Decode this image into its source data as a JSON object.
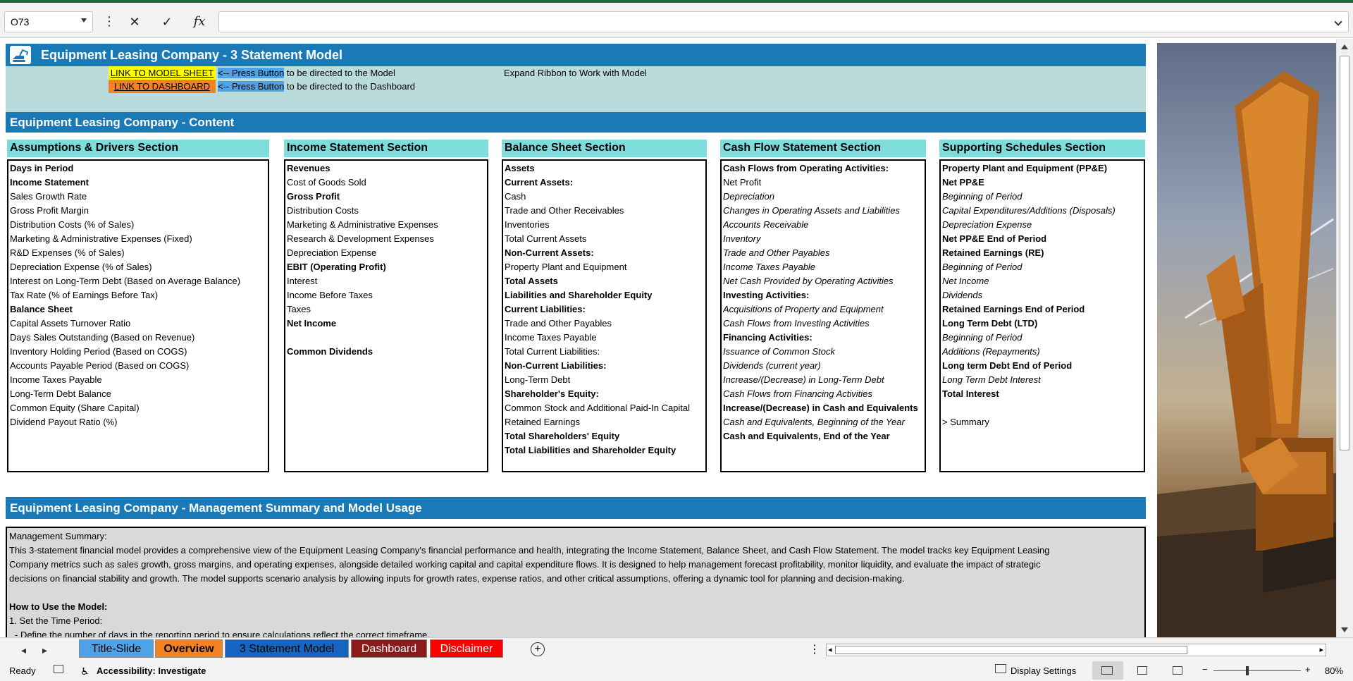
{
  "formula_bar": {
    "name_box": "O73",
    "cancel_glyph": "✕",
    "enter_glyph": "✓",
    "fx_glyph": "fx",
    "formula": ""
  },
  "header": {
    "title": "Equipment Leasing Company - 3 Statement Model",
    "link_model": "LINK TO MODEL SHEET",
    "link_dashboard": "LINK TO DASHBOARD",
    "press_prefix": "<-- Press Butt",
    "press_hl_tail": "on",
    "press_model_rest": " to be directed to the Model",
    "press_dashboard_rest": " to be directed to the Dashboard",
    "expand_note": "Expand Ribbon to Work with Model"
  },
  "content_title": "Equipment Leasing Company - Content",
  "sections": [
    {
      "title": "Assumptions & Drivers Section",
      "rows": [
        {
          "t": "Days in Period",
          "s": "b"
        },
        {
          "t": "Income Statement",
          "s": "b"
        },
        {
          "t": "Sales Growth Rate",
          "s": ""
        },
        {
          "t": "Gross Profit Margin",
          "s": ""
        },
        {
          "t": "Distribution Costs (% of Sales)",
          "s": ""
        },
        {
          "t": "Marketing & Administrative Expenses (Fixed)",
          "s": ""
        },
        {
          "t": "R&D Expenses (% of Sales)",
          "s": ""
        },
        {
          "t": "Depreciation Expense (% of Sales)",
          "s": ""
        },
        {
          "t": "Interest on Long-Term Debt (Based on Average Balance)",
          "s": ""
        },
        {
          "t": "Tax Rate (% of Earnings Before Tax)",
          "s": ""
        },
        {
          "t": "Balance Sheet",
          "s": "b"
        },
        {
          "t": "Capital Assets Turnover Ratio",
          "s": ""
        },
        {
          "t": "Days Sales Outstanding (Based on Revenue)",
          "s": ""
        },
        {
          "t": "Inventory Holding Period (Based on COGS)",
          "s": ""
        },
        {
          "t": "Accounts Payable Period (Based on COGS)",
          "s": ""
        },
        {
          "t": "Income Taxes Payable",
          "s": ""
        },
        {
          "t": "Long-Term Debt Balance",
          "s": ""
        },
        {
          "t": "Common Equity (Share Capital)",
          "s": ""
        },
        {
          "t": "Dividend Payout Ratio (%)",
          "s": ""
        }
      ]
    },
    {
      "title": "Income Statement Section",
      "rows": [
        {
          "t": "Revenues",
          "s": "b"
        },
        {
          "t": "Cost of Goods Sold",
          "s": ""
        },
        {
          "t": "Gross Profit",
          "s": "b"
        },
        {
          "t": "Distribution Costs",
          "s": ""
        },
        {
          "t": "Marketing & Administrative Expenses",
          "s": ""
        },
        {
          "t": "Research & Development Expenses",
          "s": ""
        },
        {
          "t": "Depreciation Expense",
          "s": ""
        },
        {
          "t": "EBIT (Operating Profit)",
          "s": "b"
        },
        {
          "t": "Interest",
          "s": ""
        },
        {
          "t": "Income Before Taxes",
          "s": ""
        },
        {
          "t": "Taxes",
          "s": ""
        },
        {
          "t": "Net Income",
          "s": "b"
        },
        {
          "t": "",
          "s": ""
        },
        {
          "t": "Common Dividends",
          "s": "b"
        }
      ]
    },
    {
      "title": "Balance Sheet Section",
      "rows": [
        {
          "t": "Assets",
          "s": "b"
        },
        {
          "t": "Current Assets:",
          "s": "b"
        },
        {
          "t": "Cash",
          "s": ""
        },
        {
          "t": "Trade and Other Receivables",
          "s": ""
        },
        {
          "t": "Inventories",
          "s": ""
        },
        {
          "t": "Total Current Assets",
          "s": ""
        },
        {
          "t": "Non-Current Assets:",
          "s": "b"
        },
        {
          "t": "Property Plant and Equipment",
          "s": ""
        },
        {
          "t": "Total Assets",
          "s": "b"
        },
        {
          "t": "Liabilities and Shareholder Equity",
          "s": "b"
        },
        {
          "t": "Current Liabilities:",
          "s": "b"
        },
        {
          "t": "Trade and Other Payables",
          "s": ""
        },
        {
          "t": "Income Taxes Payable",
          "s": ""
        },
        {
          "t": "Total Current Liabilities:",
          "s": ""
        },
        {
          "t": "Non-Current Liabilities:",
          "s": "b"
        },
        {
          "t": "Long-Term Debt",
          "s": ""
        },
        {
          "t": "Shareholder's Equity:",
          "s": "b"
        },
        {
          "t": "Common Stock and Additional Paid-In Capital",
          "s": ""
        },
        {
          "t": "Retained Earnings",
          "s": ""
        },
        {
          "t": "Total Shareholders' Equity",
          "s": "b"
        },
        {
          "t": "Total Liabilities and Shareholder Equity",
          "s": "b"
        }
      ]
    },
    {
      "title": "Cash Flow Statement Section",
      "rows": [
        {
          "t": "Cash Flows from Operating Activities:",
          "s": "b"
        },
        {
          "t": "Net Profit",
          "s": ""
        },
        {
          "t": "Depreciation",
          "s": "i"
        },
        {
          "t": "Changes in Operating Assets and Liabilities",
          "s": "i"
        },
        {
          "t": "Accounts Receivable",
          "s": "i"
        },
        {
          "t": "Inventory",
          "s": "i"
        },
        {
          "t": "Trade and Other Payables",
          "s": "i"
        },
        {
          "t": "Income Taxes Payable",
          "s": "i"
        },
        {
          "t": "Net Cash Provided by Operating Activities",
          "s": "i"
        },
        {
          "t": "Investing Activities:",
          "s": "b"
        },
        {
          "t": "Acquisitions of Property and Equipment",
          "s": "i"
        },
        {
          "t": "Cash Flows from Investing Activities",
          "s": "i"
        },
        {
          "t": "Financing Activities:",
          "s": "b"
        },
        {
          "t": "Issuance of Common Stock",
          "s": "i"
        },
        {
          "t": "Dividends (current year)",
          "s": "i"
        },
        {
          "t": "Increase/(Decrease) in Long-Term Debt",
          "s": "i"
        },
        {
          "t": "Cash Flows from Financing Activities",
          "s": "i"
        },
        {
          "t": "Increase/(Decrease) in Cash and Equivalents",
          "s": "b"
        },
        {
          "t": "Cash and Equivalents, Beginning of the Year",
          "s": "i"
        },
        {
          "t": "Cash and Equivalents, End of the Year",
          "s": "b"
        }
      ]
    },
    {
      "title": "Supporting Schedules Section",
      "rows": [
        {
          "t": "Property Plant and Equipment (PP&E)",
          "s": "b"
        },
        {
          "t": "Net PP&E",
          "s": "b"
        },
        {
          "t": "Beginning of Period",
          "s": "i"
        },
        {
          "t": "Capital Expenditures/Additions (Disposals)",
          "s": "i"
        },
        {
          "t": "Depreciation Expense",
          "s": "i"
        },
        {
          "t": "Net PP&E End of Period",
          "s": "b"
        },
        {
          "t": "Retained Earnings (RE)",
          "s": "b"
        },
        {
          "t": "Beginning of Period",
          "s": "i"
        },
        {
          "t": "Net Income",
          "s": "i"
        },
        {
          "t": "Dividends",
          "s": "i"
        },
        {
          "t": "Retained Earnings End of Period",
          "s": "b"
        },
        {
          "t": "Long Term Debt (LTD)",
          "s": "b"
        },
        {
          "t": "Beginning of Period",
          "s": "i"
        },
        {
          "t": "Additions (Repayments)",
          "s": "i"
        },
        {
          "t": "Long term Debt End of Period",
          "s": "b"
        },
        {
          "t": "Long Term Debt Interest",
          "s": "i"
        },
        {
          "t": "Total Interest",
          "s": "b"
        },
        {
          "t": "",
          "s": ""
        },
        {
          "t": "> Summary",
          "s": ""
        }
      ]
    }
  ],
  "summary_title": "Equipment Leasing Company - Management Summary and Model Usage",
  "summary": {
    "label": "Management Summary:",
    "line1": "This 3-statement financial model provides a comprehensive view of the Equipment Leasing Company's financial performance and health, integrating the Income Statement, Balance Sheet, and Cash Flow Statement. The model tracks key Equipment Leasing",
    "line2": "Company metrics such as sales growth, gross margins, and operating expenses, alongside detailed working capital and capital expenditure flows. It is designed to help management forecast profitability, monitor liquidity, and evaluate the impact of strategic",
    "line3": "decisions on financial stability and growth. The model supports scenario analysis by allowing inputs for growth rates, expense ratios, and other critical assumptions, offering a dynamic tool for planning and decision-making.",
    "how_title": "How to Use the Model:",
    "step1": "1. Set the Time Period:",
    "step1_detail": "- Define the number of days in the reporting period to ensure calculations reflect the correct timeframe."
  },
  "tabs": [
    {
      "label": "Title-Slide",
      "bg": "#4ea3e8",
      "fg": "#000000",
      "bold": false
    },
    {
      "label": "Overview",
      "bg": "#f58220",
      "fg": "#000000",
      "bold": true
    },
    {
      "label": "3 Statement Model",
      "bg": "#1565c0",
      "fg": "#000000",
      "bold": false
    },
    {
      "label": "Dashboard",
      "bg": "#8b1a1a",
      "fg": "#ffffff",
      "bold": false
    },
    {
      "label": "Disclaimer",
      "bg": "#ff0000",
      "fg": "#ffffff",
      "bold": false
    }
  ],
  "tab_add": "+",
  "status": {
    "ready": "Ready",
    "accessibility": "Accessibility: Investigate",
    "display_settings": "Display Settings",
    "zoom_minus": "−",
    "zoom_plus": "+",
    "zoom": "80%"
  },
  "colors": {
    "banner": "#1a7ab8",
    "light_panel": "#b9dbdc",
    "section_header": "#7fdcdc"
  }
}
